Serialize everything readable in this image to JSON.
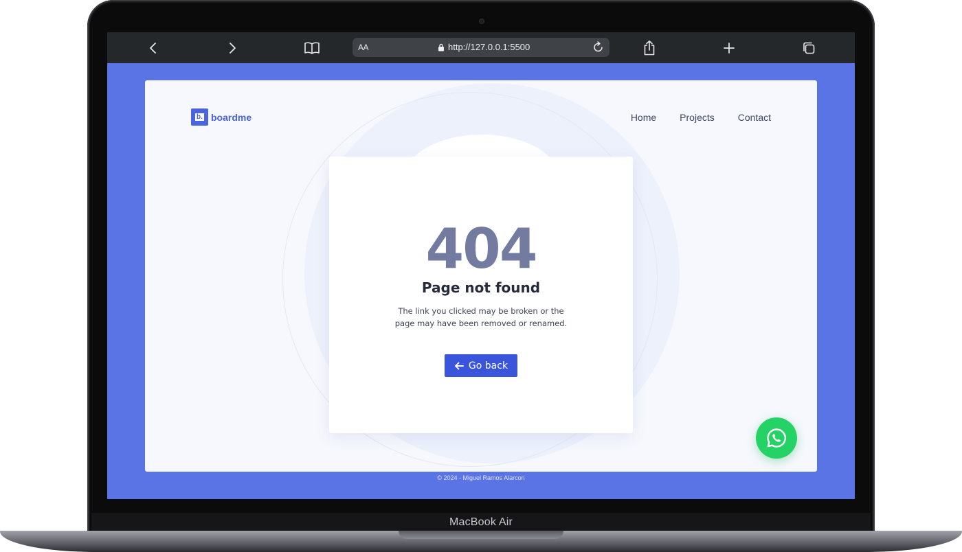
{
  "device": {
    "label": "MacBook Air"
  },
  "browser": {
    "text_size_label": "AA",
    "url": "http://127.0.0.1:5500"
  },
  "site": {
    "logo_mark": "b.",
    "logo_text": "boardme",
    "nav": [
      {
        "label": "Home"
      },
      {
        "label": "Projects"
      },
      {
        "label": "Contact"
      }
    ]
  },
  "error": {
    "code": "404",
    "title": "Page not found",
    "description": "The link you clicked may be broken or the page may have been removed or renamed.",
    "button_label": "Go back"
  },
  "footer": {
    "text": "© 2024 - Miguel Ramos Alarcon"
  },
  "colors": {
    "screen_background": "#5a74e6",
    "brand": "#4a63df",
    "button": "#3a55db",
    "whatsapp": "#25d266",
    "error_code": "#737ca0"
  },
  "icons": {
    "toolbar": [
      "chevron-left-icon",
      "chevron-right-icon",
      "book-icon",
      "lock-icon",
      "reload-icon",
      "share-icon",
      "plus-icon",
      "tabs-icon"
    ],
    "button": "arrow-left-icon",
    "floating": "whatsapp-icon"
  }
}
